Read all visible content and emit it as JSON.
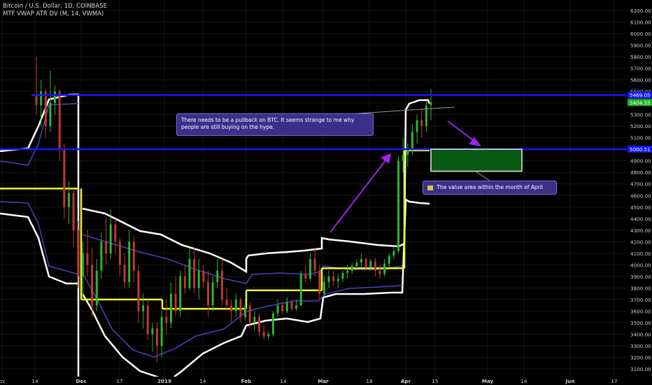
{
  "header": {
    "symbol_line": "Bitcoin / U.S. Dollar, 1D, COINBASE",
    "indicator_line": "MTF VWAP ATR DV (M, 14, VWMA)"
  },
  "annotations": {
    "note_pullback": "There needs to be a pullback on BTC. It seems strange to me why people are still buying on the hype.",
    "note_value_area": "The value area within the month of April",
    "note_value_area_icon": "chart-icon"
  },
  "colors": {
    "background": "#000000",
    "up_candle": "#2fb52f",
    "down_candle": "#c0392b",
    "vwap_line": "#f2f230",
    "atr_band": "#ffffff",
    "inner_band": "#4b3fbf",
    "horizontal_level": "#1515ff",
    "value_area_fill": "#0a5a14",
    "value_area_border": "#e6e6e6",
    "arrow": "#a020f0",
    "last_price_badge": "#1fb51f",
    "level_badge": "#1515ff"
  },
  "chart_data": {
    "type": "candlestick",
    "title": "Bitcoin / U.S. Dollar, 1D, COINBASE",
    "x_tick_labels": [
      "ov",
      "14",
      "Dec",
      "17",
      "2019",
      "14",
      "Feb",
      "14",
      "Mar",
      "18",
      "Apr",
      "15",
      "May",
      "14",
      "Jun",
      "17"
    ],
    "y_tick_labels": [
      "6200.00",
      "6100.00",
      "6000.00",
      "5900.00",
      "5800.00",
      "5700.00",
      "5600.00",
      "5500.00",
      "5400.00",
      "5300.00",
      "5200.00",
      "5100.00",
      "4900.00",
      "4800.00",
      "4700.00",
      "4600.00",
      "4500.00",
      "4400.00",
      "4300.00",
      "4200.00",
      "4100.00",
      "4000.00",
      "3900.00",
      "3800.00",
      "3700.00",
      "3600.00",
      "3500.00",
      "3400.00",
      "3300.00",
      "3200.00",
      "3100.00"
    ],
    "ylim": [
      3050,
      6260
    ],
    "price_levels": [
      {
        "label": "5469.05",
        "value": 5469.05,
        "style": "horizontal-line"
      },
      {
        "label": "5000.51",
        "value": 5000.51,
        "style": "horizontal-line"
      }
    ],
    "last_price": {
      "label": "5404.55",
      "value": 5404.55
    },
    "vwap_monthly": [
      {
        "from": "Nov",
        "to": "Nov 30",
        "value": 4660
      },
      {
        "from": "Dec",
        "to": "Dec 31",
        "value": 3700
      },
      {
        "from": "Jan",
        "to": "Jan 31",
        "value": 3620
      },
      {
        "from": "Feb",
        "to": "Feb 28",
        "value": 3780
      },
      {
        "from": "Mar",
        "to": "Mar 31",
        "value": 3970
      },
      {
        "from": "Apr",
        "to": "Apr 6",
        "value": 4990
      }
    ],
    "value_area_box": {
      "month": "April",
      "top": 5000,
      "bottom": 4810
    },
    "candles": [
      {
        "o": 5460,
        "h": 5800,
        "l": 5300,
        "c": 5380
      },
      {
        "o": 5380,
        "h": 5600,
        "l": 5200,
        "c": 5500
      },
      {
        "o": 5500,
        "h": 5520,
        "l": 5100,
        "c": 5200
      },
      {
        "o": 5200,
        "h": 5680,
        "l": 5150,
        "c": 5400
      },
      {
        "o": 5400,
        "h": 5550,
        "l": 5300,
        "c": 5500
      },
      {
        "o": 5500,
        "h": 5520,
        "l": 4900,
        "c": 5000
      },
      {
        "o": 5000,
        "h": 5050,
        "l": 4400,
        "c": 4500
      },
      {
        "o": 4500,
        "h": 4720,
        "l": 4350,
        "c": 4620
      },
      {
        "o": 4620,
        "h": 4650,
        "l": 4150,
        "c": 4300
      },
      {
        "o": 4300,
        "h": 4380,
        "l": 3800,
        "c": 3900
      },
      {
        "o": 3900,
        "h": 4200,
        "l": 3700,
        "c": 4100
      },
      {
        "o": 4100,
        "h": 4300,
        "l": 3900,
        "c": 4000
      },
      {
        "o": 4000,
        "h": 4150,
        "l": 3550,
        "c": 3650
      },
      {
        "o": 3650,
        "h": 4050,
        "l": 3600,
        "c": 3950
      },
      {
        "o": 3950,
        "h": 4280,
        "l": 3880,
        "c": 4200
      },
      {
        "o": 4200,
        "h": 4400,
        "l": 4000,
        "c": 4100
      },
      {
        "o": 4100,
        "h": 4480,
        "l": 4050,
        "c": 4350
      },
      {
        "o": 4350,
        "h": 4400,
        "l": 4100,
        "c": 4200
      },
      {
        "o": 4200,
        "h": 4230,
        "l": 3900,
        "c": 4000
      },
      {
        "o": 4000,
        "h": 4100,
        "l": 3800,
        "c": 3850
      },
      {
        "o": 3850,
        "h": 4300,
        "l": 3800,
        "c": 4200
      },
      {
        "o": 4200,
        "h": 4250,
        "l": 3850,
        "c": 3950
      },
      {
        "o": 3950,
        "h": 4000,
        "l": 3500,
        "c": 3600
      },
      {
        "o": 3600,
        "h": 3750,
        "l": 3450,
        "c": 3650
      },
      {
        "o": 3650,
        "h": 3700,
        "l": 3350,
        "c": 3400
      },
      {
        "o": 3400,
        "h": 3500,
        "l": 3250,
        "c": 3450
      },
      {
        "o": 3450,
        "h": 3500,
        "l": 3150,
        "c": 3300
      },
      {
        "o": 3300,
        "h": 3600,
        "l": 3200,
        "c": 3550
      },
      {
        "o": 3550,
        "h": 3700,
        "l": 3400,
        "c": 3500
      },
      {
        "o": 3500,
        "h": 3850,
        "l": 3450,
        "c": 3750
      },
      {
        "o": 3750,
        "h": 3900,
        "l": 3550,
        "c": 3600
      },
      {
        "o": 3600,
        "h": 3950,
        "l": 3550,
        "c": 3900
      },
      {
        "o": 3900,
        "h": 4000,
        "l": 3750,
        "c": 3800
      },
      {
        "o": 3800,
        "h": 4150,
        "l": 3780,
        "c": 4050
      },
      {
        "o": 4050,
        "h": 4150,
        "l": 3750,
        "c": 3800
      },
      {
        "o": 3800,
        "h": 4050,
        "l": 3700,
        "c": 3950
      },
      {
        "o": 3950,
        "h": 4000,
        "l": 3800,
        "c": 3850
      },
      {
        "o": 3850,
        "h": 3950,
        "l": 3550,
        "c": 3650
      },
      {
        "o": 3650,
        "h": 3900,
        "l": 3600,
        "c": 3850
      },
      {
        "o": 3850,
        "h": 4050,
        "l": 3800,
        "c": 3950
      },
      {
        "o": 3950,
        "h": 4050,
        "l": 3650,
        "c": 3700
      },
      {
        "o": 3700,
        "h": 3800,
        "l": 3600,
        "c": 3650
      },
      {
        "o": 3650,
        "h": 3700,
        "l": 3500,
        "c": 3600
      },
      {
        "o": 3600,
        "h": 3750,
        "l": 3550,
        "c": 3700
      },
      {
        "o": 3700,
        "h": 3720,
        "l": 3500,
        "c": 3550
      },
      {
        "o": 3550,
        "h": 3700,
        "l": 3520,
        "c": 3650
      },
      {
        "o": 3650,
        "h": 3680,
        "l": 3450,
        "c": 3500
      },
      {
        "o": 3500,
        "h": 3600,
        "l": 3430,
        "c": 3550
      },
      {
        "o": 3550,
        "h": 3580,
        "l": 3380,
        "c": 3420
      },
      {
        "o": 3420,
        "h": 3480,
        "l": 3350,
        "c": 3380
      },
      {
        "o": 3380,
        "h": 3420,
        "l": 3350,
        "c": 3400
      },
      {
        "o": 3400,
        "h": 3600,
        "l": 3380,
        "c": 3580
      },
      {
        "o": 3580,
        "h": 3700,
        "l": 3550,
        "c": 3650
      },
      {
        "o": 3650,
        "h": 3680,
        "l": 3570,
        "c": 3600
      },
      {
        "o": 3600,
        "h": 3720,
        "l": 3580,
        "c": 3680
      },
      {
        "o": 3680,
        "h": 3700,
        "l": 3600,
        "c": 3620
      },
      {
        "o": 3620,
        "h": 3700,
        "l": 3600,
        "c": 3650
      },
      {
        "o": 3650,
        "h": 3950,
        "l": 3640,
        "c": 3920
      },
      {
        "o": 3920,
        "h": 4000,
        "l": 3850,
        "c": 3880
      },
      {
        "o": 3880,
        "h": 4100,
        "l": 3860,
        "c": 4050
      },
      {
        "o": 4050,
        "h": 4150,
        "l": 3900,
        "c": 3950
      },
      {
        "o": 3950,
        "h": 4000,
        "l": 3700,
        "c": 3750
      },
      {
        "o": 3750,
        "h": 3900,
        "l": 3720,
        "c": 3850
      },
      {
        "o": 3850,
        "h": 3950,
        "l": 3800,
        "c": 3900
      },
      {
        "o": 3900,
        "h": 3950,
        "l": 3820,
        "c": 3860
      },
      {
        "o": 3860,
        "h": 3920,
        "l": 3800,
        "c": 3880
      },
      {
        "o": 3880,
        "h": 3950,
        "l": 3850,
        "c": 3930
      },
      {
        "o": 3930,
        "h": 4000,
        "l": 3880,
        "c": 3950
      },
      {
        "o": 3950,
        "h": 4020,
        "l": 3920,
        "c": 3990
      },
      {
        "o": 3990,
        "h": 4050,
        "l": 3950,
        "c": 4020
      },
      {
        "o": 4020,
        "h": 4100,
        "l": 3980,
        "c": 4050
      },
      {
        "o": 4050,
        "h": 4070,
        "l": 3950,
        "c": 3980
      },
      {
        "o": 3980,
        "h": 4050,
        "l": 3950,
        "c": 4030
      },
      {
        "o": 4030,
        "h": 4060,
        "l": 3900,
        "c": 3950
      },
      {
        "o": 3950,
        "h": 4000,
        "l": 3880,
        "c": 3920
      },
      {
        "o": 3920,
        "h": 4050,
        "l": 3900,
        "c": 4010
      },
      {
        "o": 4010,
        "h": 4100,
        "l": 3980,
        "c": 4080
      },
      {
        "o": 4080,
        "h": 4150,
        "l": 4050,
        "c": 4120
      },
      {
        "o": 4120,
        "h": 4950,
        "l": 4100,
        "c": 4900
      },
      {
        "o": 4900,
        "h": 5100,
        "l": 4800,
        "c": 4950
      },
      {
        "o": 4950,
        "h": 5050,
        "l": 4850,
        "c": 5000
      },
      {
        "o": 5000,
        "h": 5220,
        "l": 4950,
        "c": 5150
      },
      {
        "o": 5150,
        "h": 5300,
        "l": 5050,
        "c": 5250
      },
      {
        "o": 5250,
        "h": 5350,
        "l": 5100,
        "c": 5200
      },
      {
        "o": 5200,
        "h": 5420,
        "l": 5150,
        "c": 5380
      },
      {
        "o": 5380,
        "h": 5520,
        "l": 5250,
        "c": 5405
      }
    ]
  }
}
